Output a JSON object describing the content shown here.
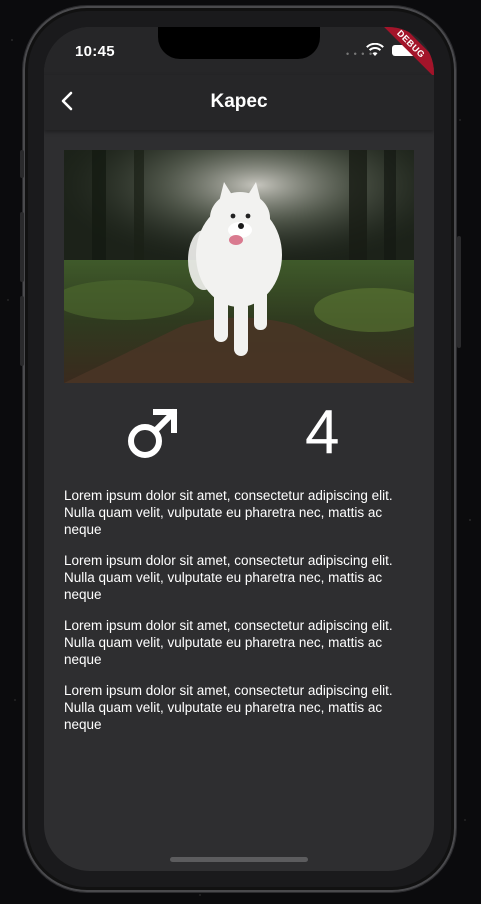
{
  "status_bar": {
    "time": "10:45",
    "debug_banner": "DEBUG",
    "icons": [
      "signal-dots-icon",
      "wifi-icon",
      "battery-icon"
    ]
  },
  "app_bar": {
    "title": "Kapec",
    "back_icon": "chevron-left-icon"
  },
  "pet": {
    "photo": "white-samoyed-dog-running-in-forest",
    "gender_icon": "male-symbol-icon",
    "age": "4"
  },
  "paragraphs": [
    "Lorem ipsum dolor sit amet, consectetur adipiscing elit. Nulla quam velit, vulputate eu pharetra nec, mattis ac neque",
    "Lorem ipsum dolor sit amet, consectetur adipiscing elit. Nulla quam velit, vulputate eu pharetra nec, mattis ac neque",
    "Lorem ipsum dolor sit amet, consectetur adipiscing elit. Nulla quam velit, vulputate eu pharetra nec, mattis ac neque",
    "Lorem ipsum dolor sit amet, consectetur adipiscing elit. Nulla quam velit, vulputate eu pharetra nec, mattis ac neque"
  ],
  "colors": {
    "background": "#2e2e30",
    "app_bar": "#262628",
    "debug_banner": "#a3142a",
    "text": "#ffffff"
  }
}
